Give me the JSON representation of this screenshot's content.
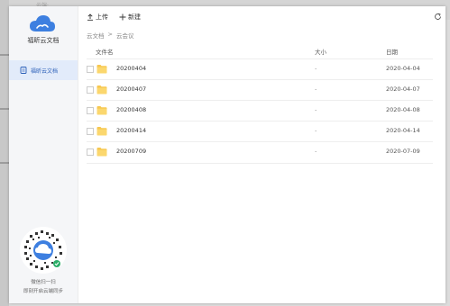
{
  "background": {
    "ghost_text": "云端·…"
  },
  "app": {
    "name": "福昕云文档"
  },
  "sidebar": {
    "items": [
      {
        "label": "福昕云文档",
        "icon": "document-icon",
        "active": true
      }
    ],
    "qr": {
      "line1": "微信扫一扫",
      "line2": "即刻开启云端同步"
    }
  },
  "toolbar": {
    "upload_label": "上传",
    "new_label": "新建",
    "icons": [
      "upload-icon",
      "plus-icon",
      "refresh-icon",
      "avatar",
      "chevron-down-icon",
      "minimize-icon",
      "close-icon"
    ]
  },
  "breadcrumb": {
    "root": "云文档",
    "separator": ">",
    "current": "云会议"
  },
  "table": {
    "headers": {
      "name": "文件名",
      "size": "大小",
      "date": "日期"
    },
    "rows": [
      {
        "name": "20200404",
        "size": "-",
        "date": "2020-04-04"
      },
      {
        "name": "20200407",
        "size": "-",
        "date": "2020-04-07"
      },
      {
        "name": "20200408",
        "size": "-",
        "date": "2020-04-08"
      },
      {
        "name": "20200414",
        "size": "-",
        "date": "2020-04-14"
      },
      {
        "name": "20200709",
        "size": "-",
        "date": "2020-07-09"
      }
    ]
  },
  "colors": {
    "accent": "#3d7fe0",
    "folder": "#f7c74f",
    "nav_active_bg": "#e2ebfa"
  }
}
